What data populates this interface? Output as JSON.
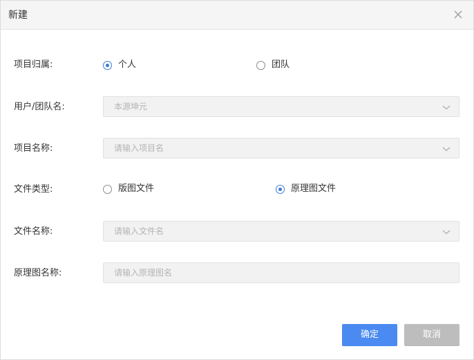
{
  "dialog": {
    "title": "新建"
  },
  "form": {
    "ownership": {
      "label": "项目归属:",
      "options": [
        {
          "label": "个人",
          "checked": true
        },
        {
          "label": "团队",
          "checked": false
        }
      ]
    },
    "user_team_name": {
      "label": "用户/团队名:",
      "value": "本源坤元"
    },
    "project_name": {
      "label": "项目名称:",
      "placeholder": "请输入项目名"
    },
    "file_type": {
      "label": "文件类型:",
      "options": [
        {
          "label": "版图文件",
          "checked": false
        },
        {
          "label": "原理图文件",
          "checked": true
        }
      ]
    },
    "file_name": {
      "label": "文件名称:",
      "placeholder": "请输入文件名"
    },
    "schematic_name": {
      "label": "原理图名称:",
      "placeholder": "请输入原理图名"
    }
  },
  "buttons": {
    "confirm": "确定",
    "cancel": "取消"
  },
  "icons": {
    "close": "close-icon",
    "dropdown": "chevron-down-icon"
  },
  "colors": {
    "accent": "#4b8af0",
    "radio_checked": "#3c7bd6",
    "cancel_bg": "#bdbdbd",
    "field_bg": "#f2f2f2"
  }
}
